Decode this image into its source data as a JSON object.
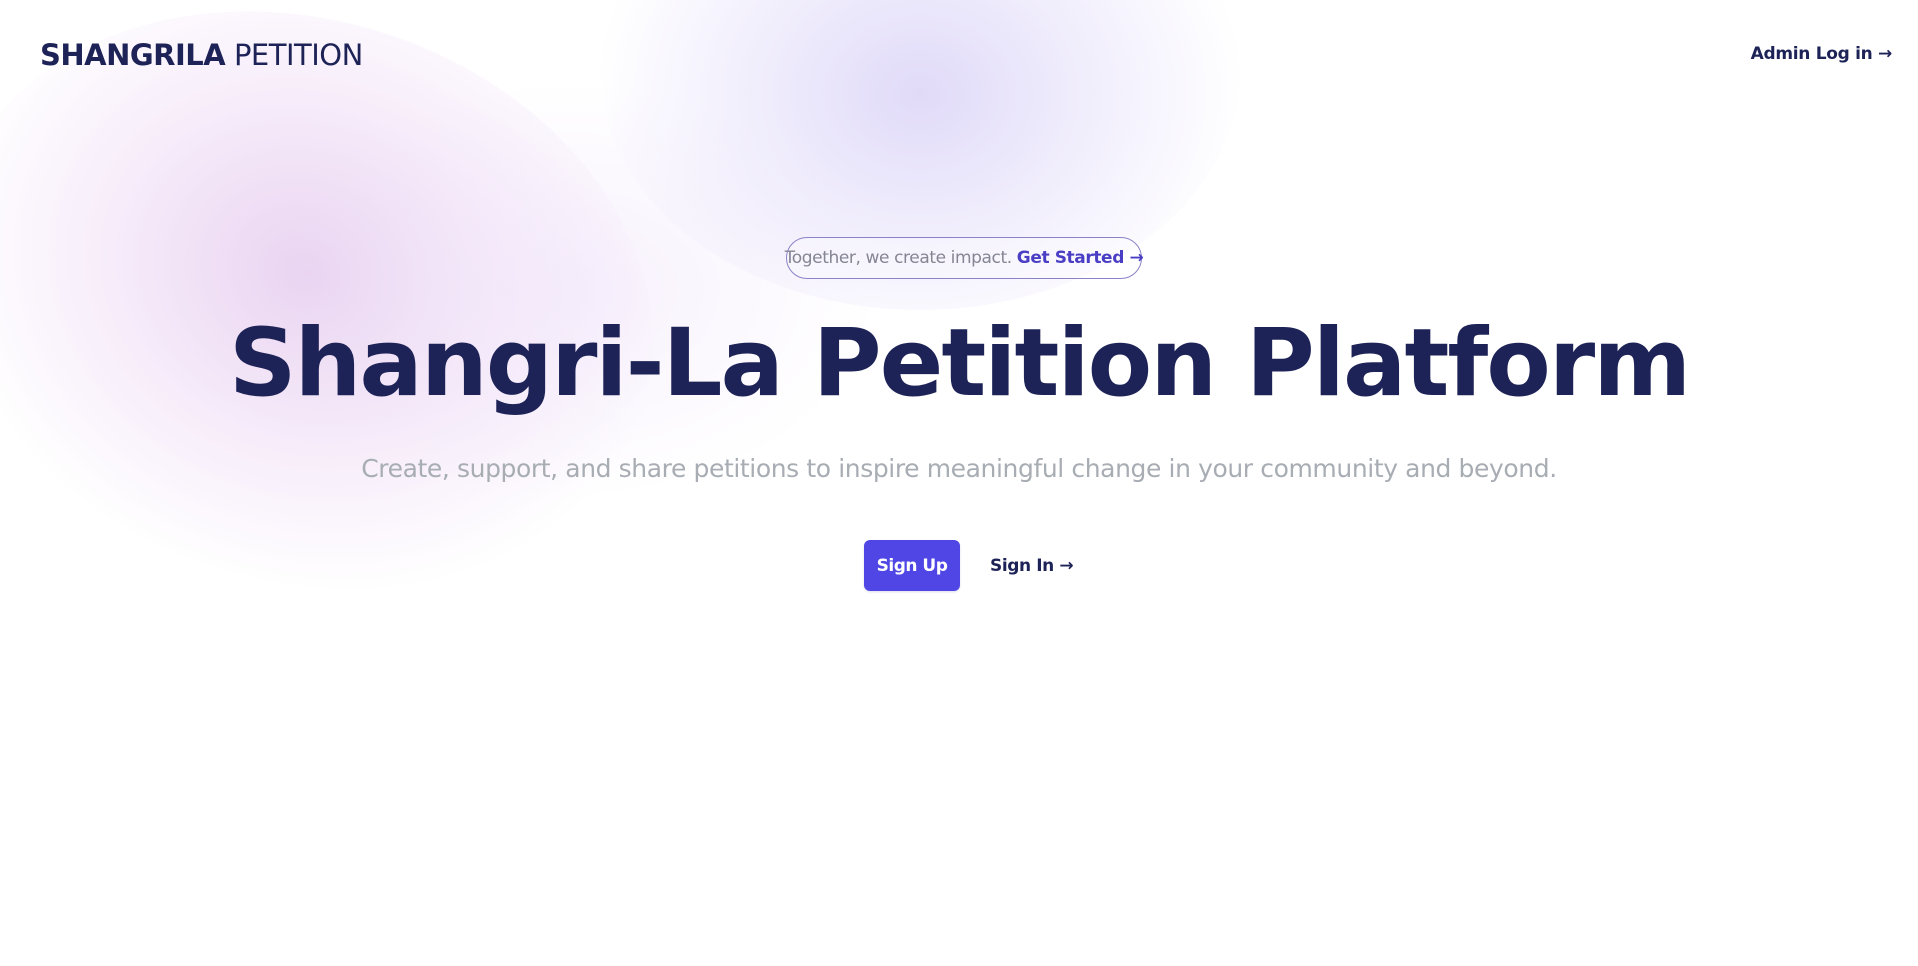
{
  "header": {
    "logo_strong": "SHANGRILA",
    "logo_light": "PETITION",
    "admin_login_label": "Admin Log in →"
  },
  "hero": {
    "badge_text": "Together, we create impact.",
    "badge_link_label": "Get Started →",
    "title": "Shangri-La Petition Platform",
    "subtitle": "Create, support, and share petitions to inspire meaningful change in your community and beyond.",
    "signup_label": "Sign Up",
    "signin_label": "Sign In →"
  },
  "colors": {
    "brand_navy": "#1e2357",
    "accent_indigo": "#4f46e5",
    "badge_link": "#4a3fc4",
    "subtitle_gray": "#a8adb4"
  }
}
